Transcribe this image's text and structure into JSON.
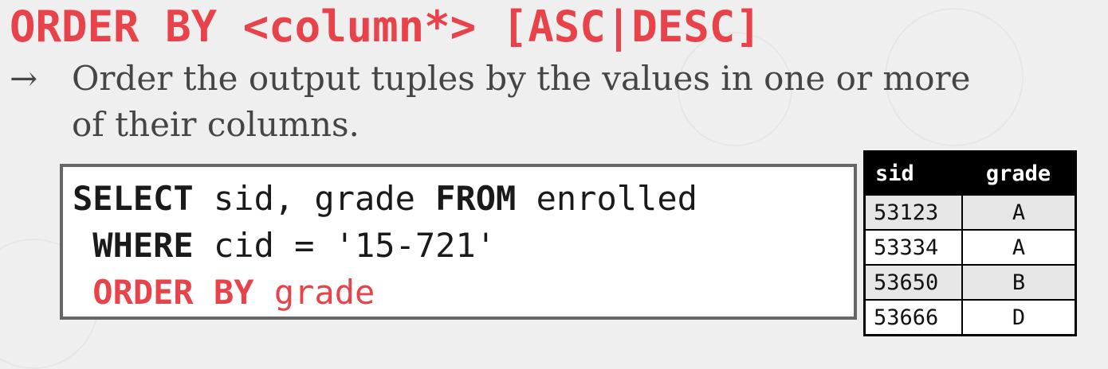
{
  "title": "ORDER BY <column*> [ASC|DESC]",
  "bullet": {
    "arrow": "→",
    "text": "Order the output tuples by the values in one or more of their columns."
  },
  "code": {
    "line1": {
      "kw1": "SELECT",
      "txt1": " sid, grade ",
      "kw2": "FROM",
      "txt2": " enrolled"
    },
    "line2": {
      "kw1": " WHERE",
      "txt1": " cid = '15-721'"
    },
    "line3": {
      "kw1": " ORDER BY",
      "txt1": " grade"
    }
  },
  "table": {
    "headers": [
      "sid",
      "grade"
    ],
    "rows": [
      {
        "sid": "53123",
        "grade": "A"
      },
      {
        "sid": "53334",
        "grade": "A"
      },
      {
        "sid": "53650",
        "grade": "B"
      },
      {
        "sid": "53666",
        "grade": "D"
      }
    ]
  },
  "colors": {
    "accent": "#e8434b",
    "background": "#efefef",
    "table_header": "#000000"
  }
}
